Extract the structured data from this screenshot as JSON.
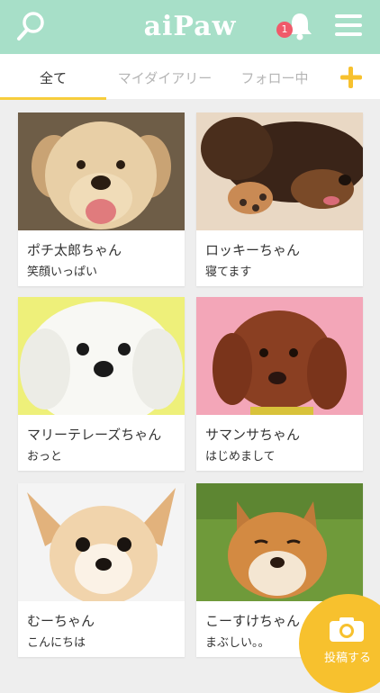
{
  "header": {
    "logo": "aiPaw",
    "notification_count": "1",
    "icons": [
      "search-icon",
      "bell-icon",
      "menu-icon"
    ],
    "color": "#a7dfc8"
  },
  "tabs": [
    {
      "label": "全て",
      "active": true
    },
    {
      "label": "マイダイアリー",
      "active": false
    },
    {
      "label": "フォロー中",
      "active": false
    }
  ],
  "accent_color": "#f7cd3c",
  "posts": [
    {
      "name": "ポチ太郎ちゃん",
      "caption": "笑顔いっぱい"
    },
    {
      "name": "ロッキーちゃん",
      "caption": "寝てます"
    },
    {
      "name": "マリーテレーズちゃん",
      "caption": "おっと"
    },
    {
      "name": "サマンサちゃん",
      "caption": "はじめまして"
    },
    {
      "name": "むーちゃん",
      "caption": "こんにちは"
    },
    {
      "name": "こーすけちゃん",
      "caption": "まぶしい。。"
    }
  ],
  "post_button": {
    "label": "投稿する",
    "icon": "camera-icon"
  }
}
